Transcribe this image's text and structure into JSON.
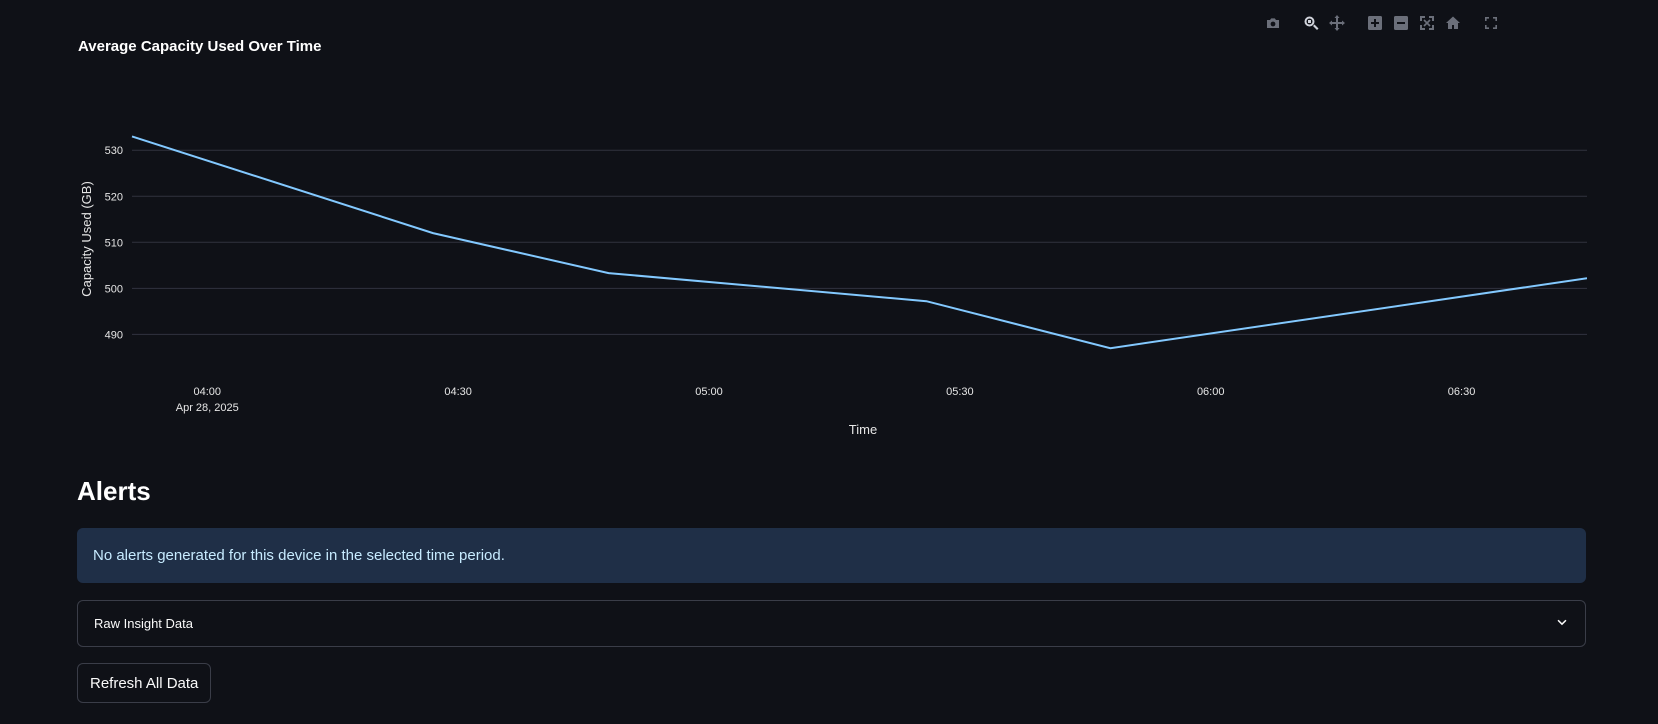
{
  "chart_data": {
    "type": "line",
    "title": "Average Capacity Used Over Time",
    "xlabel": "Time",
    "ylabel": "Capacity Used (GB)",
    "x_ticks": [
      {
        "value": "04:00",
        "sub": "Apr 28, 2025"
      },
      {
        "value": "04:30",
        "sub": ""
      },
      {
        "value": "05:00",
        "sub": ""
      },
      {
        "value": "05:30",
        "sub": ""
      },
      {
        "value": "06:00",
        "sub": ""
      },
      {
        "value": "06:30",
        "sub": ""
      }
    ],
    "y_ticks": [
      490,
      500,
      510,
      520,
      530
    ],
    "xlim": [
      "2025-04-28 03:51",
      "2025-04-28 06:45"
    ],
    "ylim": [
      484,
      537
    ],
    "grid": true,
    "series": [
      {
        "color": "#83c9ff",
        "points": [
          {
            "x": "2025-04-28 03:51",
            "y": 533
          },
          {
            "x": "2025-04-28 04:27",
            "y": 512
          },
          {
            "x": "2025-04-28 04:48",
            "y": 503.3
          },
          {
            "x": "2025-04-28 05:26",
            "y": 497.2
          },
          {
            "x": "2025-04-28 05:48",
            "y": 487
          },
          {
            "x": "2025-04-28 06:45",
            "y": 502.2
          }
        ]
      }
    ]
  },
  "modebar": [
    {
      "icon": "camera-icon",
      "label": "Download plot as a png"
    },
    {
      "icon": "zoom-icon",
      "label": "Zoom"
    },
    {
      "icon": "pan-icon",
      "label": "Pan"
    },
    {
      "icon": "zoom-in-icon",
      "label": "Zoom in"
    },
    {
      "icon": "zoom-out-icon",
      "label": "Zoom out"
    },
    {
      "icon": "autoscale-icon",
      "label": "Autoscale"
    },
    {
      "icon": "home-icon",
      "label": "Reset axes"
    },
    {
      "icon": "fullscreen-icon",
      "label": "Fullscreen"
    }
  ],
  "alerts": {
    "heading": "Alerts",
    "message": "No alerts generated for this device in the selected time period."
  },
  "expander": {
    "label": "Raw Insight Data",
    "icon": "chevron-down-icon"
  },
  "buttons": {
    "refresh_label": "Refresh All Data"
  },
  "colors": {
    "background": "#0f1117",
    "line": "#83c9ff",
    "info_bg": "#1f2f47",
    "info_text": "#c7ebff"
  }
}
